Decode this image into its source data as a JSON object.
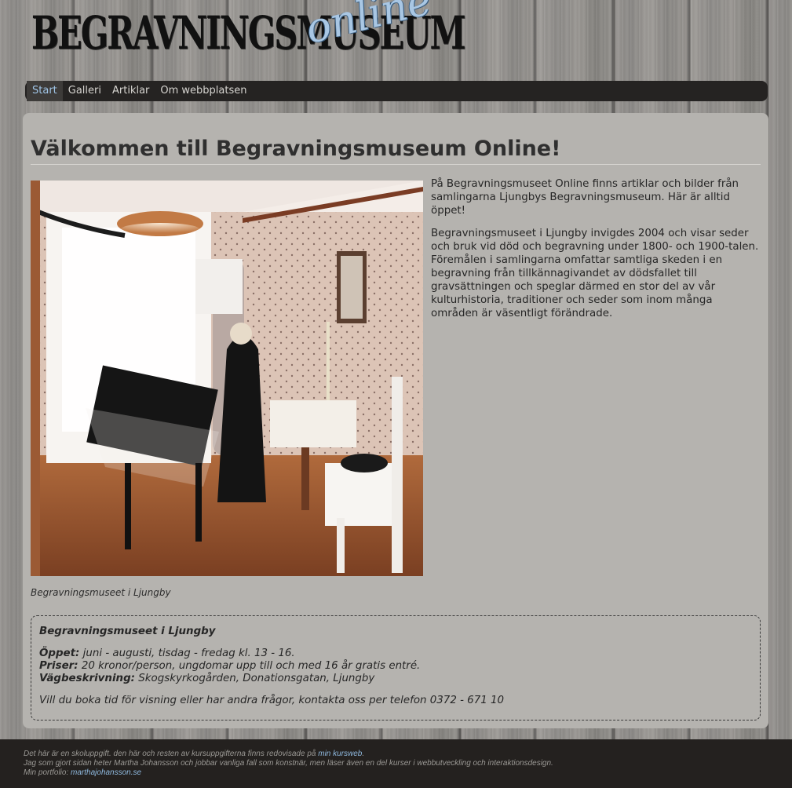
{
  "logo": {
    "main": "BEGRAVNINGSMUSEUM",
    "accent": "online"
  },
  "nav": {
    "items": [
      {
        "label": "Start",
        "active": true
      },
      {
        "label": "Galleri",
        "active": false
      },
      {
        "label": "Artiklar",
        "active": false
      },
      {
        "label": "Om webbplatsen",
        "active": false
      }
    ]
  },
  "main": {
    "title": "Välkommen till Begravningsmuseum Online!",
    "image_caption": "Begravningsmuseet i Ljungby",
    "paragraphs": [
      "På Begravningsmuseet Online finns artiklar och bilder från samlingarna Ljungbys Begravningsmuseum. Här är alltid öppet!",
      "Begravningsmuseet i Ljungby invigdes 2004 och visar seder och bruk vid död och begravning under 1800- och 1900-talen. Föremålen i samlingarna omfattar samtliga skeden i en begravning från tillkännagivandet av dödsfallet till gravsättningen och speglar därmed en stor del av vår kulturhistoria, traditioner och seder som inom många områden är väsentligt förändrade."
    ]
  },
  "info": {
    "heading": "Begravningsmuseet i Ljungby",
    "open_label": "Öppet:",
    "open_value": "juni - augusti, tisdag - fredag kl. 13 - 16.",
    "price_label": "Priser:",
    "price_value": "20 kronor/person, ungdomar upp till och med 16 år gratis entré.",
    "directions_label": "Vägbeskrivning:",
    "directions_value": "Skogskyrkogården, Donationsgatan, Ljungby",
    "contact": "Vill du boka tid för visning eller har andra frågor, kontakta oss per telefon 0372 - 671 10"
  },
  "footer": {
    "line1_text": "Det här är en skoluppgift. den här och resten av kursuppgifterna finns redovisade på",
    "line1_link": "min kursweb",
    "line1_end": ".",
    "line2": "Jag som gjort sidan heter Martha Johansson och jobbar vanliga fall som konstnär, men läser även en del kurser i webbutveckling och interaktionsdesign.",
    "line3_text": "Min portfolio:",
    "line3_link": "marthajohansson.se"
  },
  "colors": {
    "nav_bg": "#252322",
    "nav_active": "#9fc4e6",
    "panel_bg": "#b5b3af",
    "footer_bg": "#24211f",
    "link": "#8fb9de"
  }
}
